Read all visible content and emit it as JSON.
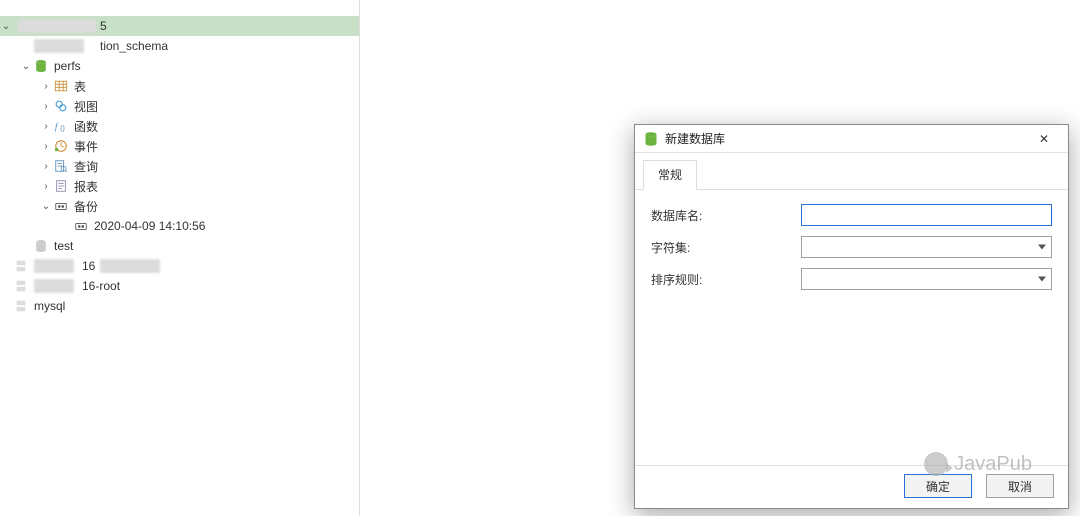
{
  "sidebar": {
    "conn_tail": "5",
    "items": [
      {
        "label": "tion_schema"
      },
      {
        "label": "perfs",
        "expanded": true
      },
      {
        "label": "表"
      },
      {
        "label": "视图"
      },
      {
        "label": "函数"
      },
      {
        "label": "事件"
      },
      {
        "label": "查询"
      },
      {
        "label": "报表"
      },
      {
        "label": "备份",
        "expanded": true
      },
      {
        "label": "2020-04-09 14:10:56"
      },
      {
        "label": "test"
      },
      {
        "label": "16"
      },
      {
        "label": "16-root"
      },
      {
        "label": "mysql"
      }
    ]
  },
  "dialog": {
    "title": "新建数据库",
    "tab_general": "常规",
    "form": {
      "db_name_label": "数据库名:",
      "charset_label": "字符集:",
      "collation_label": "排序规则:",
      "db_name_value": "",
      "charset_value": "",
      "collation_value": ""
    },
    "buttons": {
      "ok": "确定",
      "cancel": "取消"
    }
  },
  "watermark": "JavaPub",
  "icons": {
    "db_green": "db",
    "db_grey": "db_grey",
    "table": "table",
    "view": "view",
    "func": "func",
    "event": "event",
    "query": "query",
    "report": "report",
    "backup": "backup",
    "close": "close"
  },
  "glyphs": {
    "expand_open": "⌄",
    "expand_closed": "›",
    "close": "✕"
  }
}
